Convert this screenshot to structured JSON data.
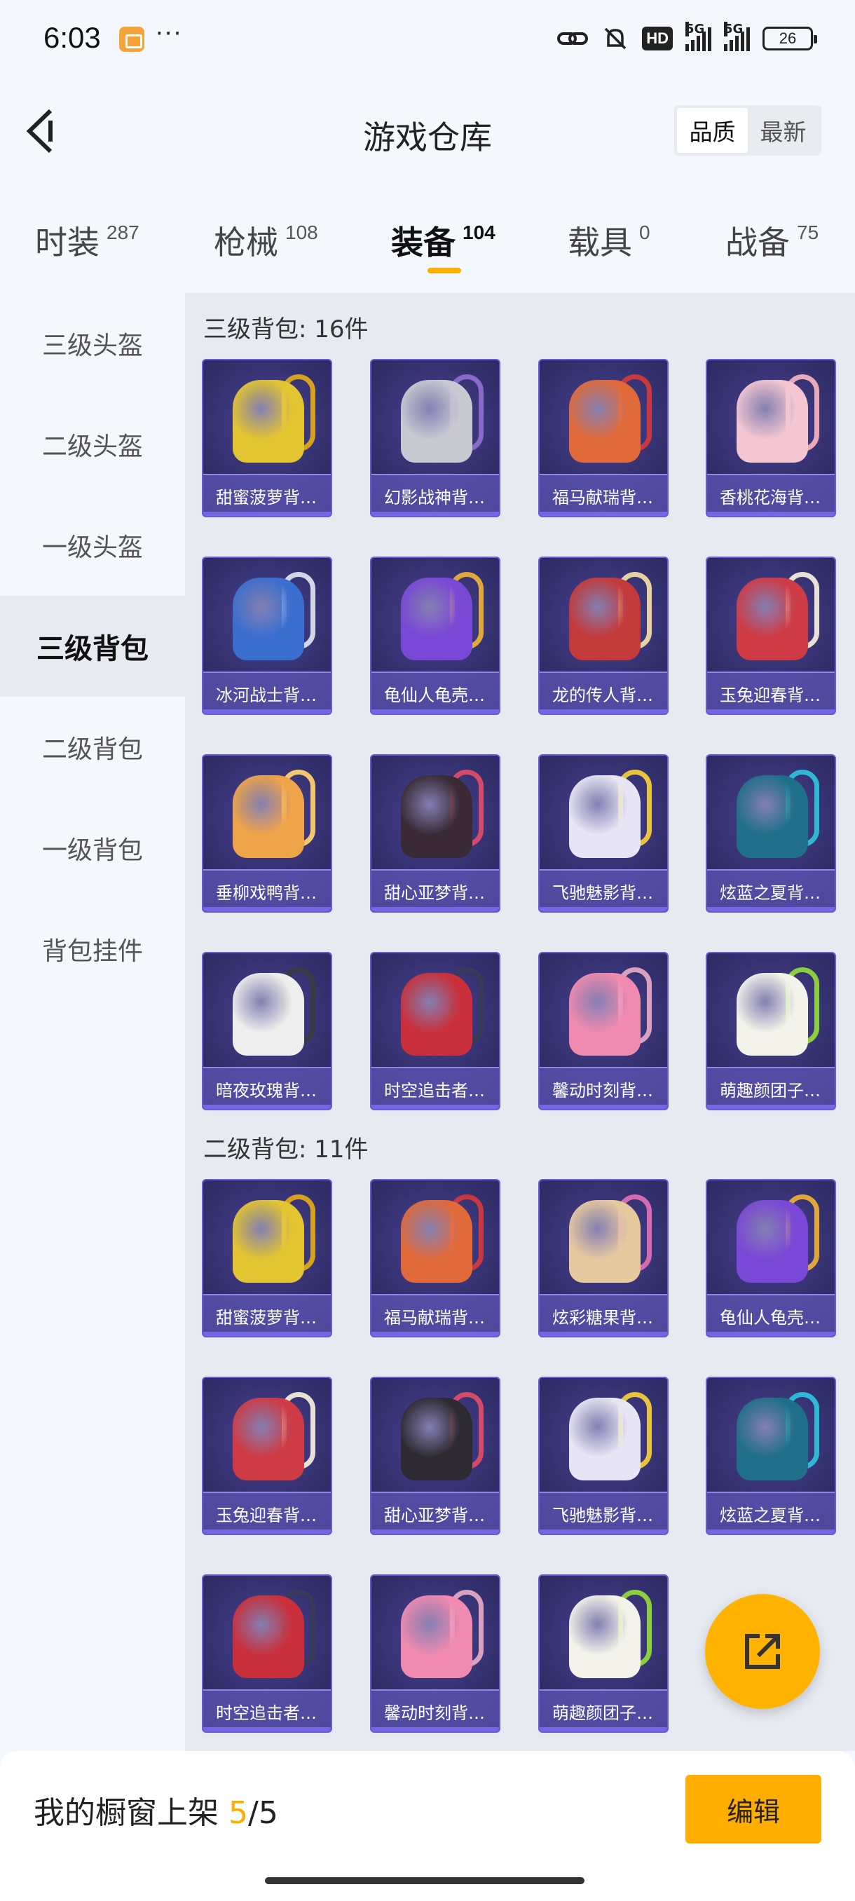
{
  "status_bar": {
    "time": "6:03",
    "overflow": "···",
    "signal_1": "5G",
    "signal_2": "5G",
    "hd": "HD",
    "battery": "26",
    "icons": [
      "app-notification-icon",
      "link-icon",
      "mute-icon",
      "hd-icon",
      "signal-icon",
      "battery-icon"
    ]
  },
  "header": {
    "title": "游戏仓库",
    "sort_quality": "品质",
    "sort_latest": "最新",
    "back_icon": "chevron-left-icon"
  },
  "tabs": [
    {
      "label": "时装",
      "count": "287"
    },
    {
      "label": "枪械",
      "count": "108"
    },
    {
      "label": "装备",
      "count": "104"
    },
    {
      "label": "载具",
      "count": "0"
    },
    {
      "label": "战备",
      "count": "75"
    }
  ],
  "active_tab": "装备",
  "sidebar": [
    {
      "label": "三级头盔"
    },
    {
      "label": "二级头盔"
    },
    {
      "label": "一级头盔"
    },
    {
      "label": "三级背包"
    },
    {
      "label": "二级背包"
    },
    {
      "label": "一级背包"
    },
    {
      "label": "背包挂件"
    }
  ],
  "active_sidebar": "三级背包",
  "sections": [
    {
      "title": "三级背包: 16件",
      "items": [
        {
          "name": "甜蜜菠萝背…",
          "color": "#e3c531",
          "strap": "#d6a11f"
        },
        {
          "name": "幻影战神背…",
          "color": "#c9c9d2",
          "strap": "#8a6ac8"
        },
        {
          "name": "福马献瑞背…",
          "color": "#e06a3a",
          "strap": "#c8383f"
        },
        {
          "name": "香桃花海背…",
          "color": "#f3c6d1",
          "strap": "#e8aab8"
        },
        {
          "name": "冰河战士背…",
          "color": "#3b6fcf",
          "strap": "#cfd6e6"
        },
        {
          "name": "龟仙人龟壳…",
          "color": "#7a48d6",
          "strap": "#e0a83a"
        },
        {
          "name": "龙的传人背…",
          "color": "#c33a3a",
          "strap": "#e6d2a0"
        },
        {
          "name": "玉兔迎春背…",
          "color": "#cf3b45",
          "strap": "#e9e0d6"
        },
        {
          "name": "垂柳戏鸭背…",
          "color": "#f0a44a",
          "strap": "#f2c56f"
        },
        {
          "name": "甜心亚梦背…",
          "color": "#3a2a36",
          "strap": "#d44a6a"
        },
        {
          "name": "飞驰魅影背…",
          "color": "#e8e6f5",
          "strap": "#e7c43c"
        },
        {
          "name": "炫蓝之夏背…",
          "color": "#1f6f8a",
          "strap": "#2fb8d6"
        },
        {
          "name": "暗夜玫瑰背…",
          "color": "#eeeeee",
          "strap": "#3a3a44"
        },
        {
          "name": "时空追击者…",
          "color": "#c9303c",
          "strap": "#3a3a5a"
        },
        {
          "name": "馨动时刻背…",
          "color": "#f08ab0",
          "strap": "#d9a0c0"
        },
        {
          "name": "萌趣颜团子…",
          "color": "#f3f3ea",
          "strap": "#8ccf3c"
        }
      ]
    },
    {
      "title": "二级背包: 11件",
      "items": [
        {
          "name": "甜蜜菠萝背…",
          "color": "#e3c531",
          "strap": "#d6a11f"
        },
        {
          "name": "福马献瑞背…",
          "color": "#e06a3a",
          "strap": "#c8383f"
        },
        {
          "name": "炫彩糖果背…",
          "color": "#e7c9a0",
          "strap": "#d46ab0"
        },
        {
          "name": "龟仙人龟壳…",
          "color": "#7a48d6",
          "strap": "#e0a83a"
        },
        {
          "name": "玉兔迎春背…",
          "color": "#cf3b45",
          "strap": "#e9e0d6"
        },
        {
          "name": "甜心亚梦背…",
          "color": "#2e2a32",
          "strap": "#d44a6a"
        },
        {
          "name": "飞驰魅影背…",
          "color": "#e8e6f5",
          "strap": "#e7c43c"
        },
        {
          "name": "炫蓝之夏背…",
          "color": "#1f6f8a",
          "strap": "#2fb8d6"
        },
        {
          "name": "时空追击者…",
          "color": "#c9303c",
          "strap": "#3a3a5a"
        },
        {
          "name": "馨动时刻背…",
          "color": "#f08ab0",
          "strap": "#d9a0c0"
        },
        {
          "name": "萌趣颜团子…",
          "color": "#f3f3ea",
          "strap": "#8ccf3c"
        }
      ]
    }
  ],
  "fab_icon": "share-external-icon",
  "bottom": {
    "window_label": "我的橱窗上架 ",
    "window_count": "5",
    "window_total": "/5",
    "edit_label": "编辑"
  },
  "colors": {
    "accent": "#ffae00",
    "card_bg": "#33306e",
    "card_border": "#6a5ad8"
  }
}
